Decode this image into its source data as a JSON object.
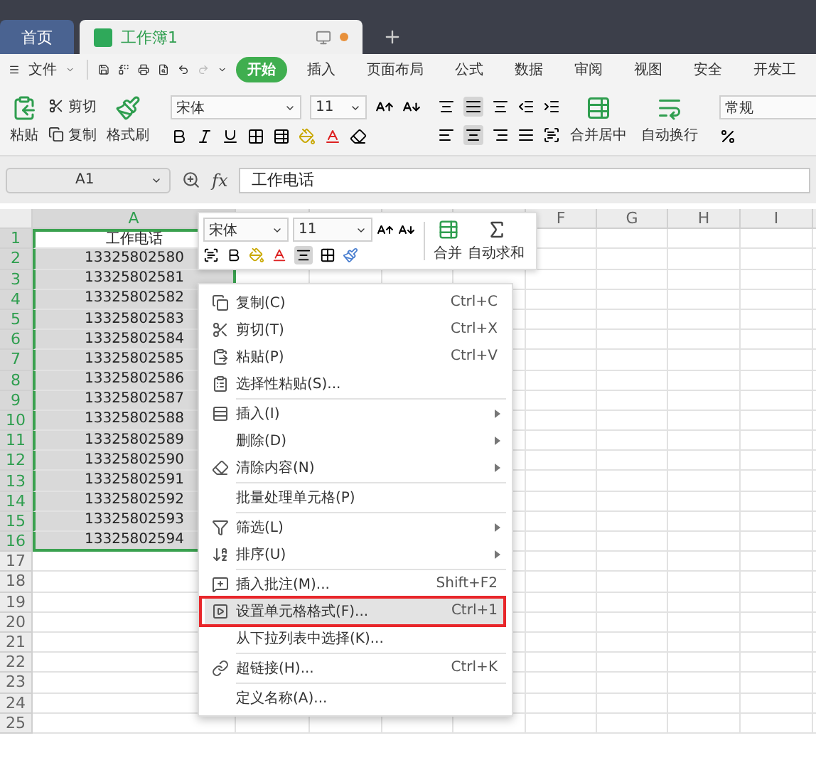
{
  "title_bar": {
    "tabs": [
      {
        "label": "首页",
        "selected": false,
        "unsaved": false
      },
      {
        "label": "工作簿1",
        "selected": true,
        "unsaved": true
      }
    ]
  },
  "menu_bar": {
    "file": "文件",
    "tabs": [
      {
        "label": "开始",
        "selected": true
      },
      {
        "label": "插入",
        "selected": false
      },
      {
        "label": "页面布局",
        "selected": false
      },
      {
        "label": "公式",
        "selected": false
      },
      {
        "label": "数据",
        "selected": false
      },
      {
        "label": "审阅",
        "selected": false
      },
      {
        "label": "视图",
        "selected": false
      },
      {
        "label": "安全",
        "selected": false
      },
      {
        "label": "开发工",
        "selected": false
      }
    ]
  },
  "ribbon": {
    "paste": "粘贴",
    "cut": "剪切",
    "copy": "复制",
    "format_painter": "格式刷",
    "font": "宋体",
    "font_size": "11",
    "merge_center": "合并居中",
    "wrap_text": "自动换行",
    "number_format": "常规"
  },
  "formula_bar": {
    "name_box": "A1",
    "fx": "fx",
    "value": "工作电话"
  },
  "sheet": {
    "columns": [
      {
        "label": "A",
        "selected": true
      },
      {
        "selected": false
      },
      {
        "selected": false
      },
      {
        "selected": false
      },
      {
        "selected": false
      },
      {
        "label": "F",
        "selected": false
      },
      {
        "label": "G",
        "selected": false
      },
      {
        "label": "H",
        "selected": false
      },
      {
        "label": "I",
        "selected": false
      }
    ],
    "rows": [
      {
        "number": "1",
        "value": "工作电话",
        "selected": true
      },
      {
        "number": "2",
        "value": "13325802580",
        "selected": true
      },
      {
        "number": "3",
        "value": "13325802581",
        "selected": true
      },
      {
        "number": "4",
        "value": "13325802582",
        "selected": true
      },
      {
        "number": "5",
        "value": "13325802583",
        "selected": true
      },
      {
        "number": "6",
        "value": "13325802584",
        "selected": true
      },
      {
        "number": "7",
        "value": "13325802585",
        "selected": true
      },
      {
        "number": "8",
        "value": "13325802586",
        "selected": true
      },
      {
        "number": "9",
        "value": "13325802587",
        "selected": true
      },
      {
        "number": "10",
        "value": "13325802588",
        "selected": true
      },
      {
        "number": "11",
        "value": "13325802589",
        "selected": true
      },
      {
        "number": "12",
        "value": "13325802590",
        "selected": true
      },
      {
        "number": "13",
        "value": "13325802591",
        "selected": true
      },
      {
        "number": "14",
        "value": "13325802592",
        "selected": true
      },
      {
        "number": "15",
        "value": "13325802593",
        "selected": true
      },
      {
        "number": "16",
        "value": "13325802594",
        "selected": true
      },
      {
        "number": "17",
        "selected": false
      },
      {
        "number": "18",
        "selected": false
      },
      {
        "number": "19",
        "selected": false
      },
      {
        "number": "20",
        "selected": false
      },
      {
        "number": "21",
        "selected": false
      },
      {
        "number": "22",
        "selected": false
      },
      {
        "number": "23",
        "selected": false
      },
      {
        "number": "24",
        "selected": false
      },
      {
        "number": "25",
        "selected": false
      }
    ]
  },
  "mini_toolbar": {
    "font": "宋体",
    "font_size": "11",
    "merge": "合并",
    "autosum": "自动求和"
  },
  "context_menu": {
    "items": [
      {
        "kind": "copy",
        "label": "复制(C)",
        "shortcut": "Ctrl+C",
        "submenu": false,
        "selected": false,
        "divider_after": false
      },
      {
        "kind": "cut",
        "label": "剪切(T)",
        "shortcut": "Ctrl+X",
        "submenu": false,
        "selected": false,
        "divider_after": false
      },
      {
        "kind": "paste",
        "label": "粘贴(P)",
        "shortcut": "Ctrl+V",
        "submenu": false,
        "selected": false,
        "divider_after": false
      },
      {
        "kind": "paste-special",
        "label": "选择性粘贴(S)...",
        "submenu": false,
        "selected": false,
        "divider_after": true
      },
      {
        "kind": "insert",
        "label": "插入(I)",
        "submenu": true,
        "selected": false,
        "divider_after": false
      },
      {
        "kind": "plain",
        "label": "删除(D)",
        "submenu": true,
        "selected": false,
        "divider_after": false
      },
      {
        "kind": "clear",
        "label": "清除内容(N)",
        "submenu": true,
        "selected": false,
        "divider_after": true
      },
      {
        "kind": "plain",
        "label": "批量处理单元格(P)",
        "submenu": false,
        "selected": false,
        "divider_after": true
      },
      {
        "kind": "filter",
        "label": "筛选(L)",
        "submenu": true,
        "selected": false,
        "divider_after": false
      },
      {
        "kind": "sort",
        "label": "排序(U)",
        "submenu": true,
        "selected": false,
        "divider_after": true
      },
      {
        "kind": "comment",
        "label": "插入批注(M)...",
        "shortcut": "Shift+F2",
        "submenu": false,
        "selected": false,
        "divider_after": false
      },
      {
        "kind": "format",
        "label": "设置单元格格式(F)...",
        "shortcut": "Ctrl+1",
        "submenu": false,
        "selected": true,
        "divider_after": false
      },
      {
        "kind": "plain",
        "label": "从下拉列表中选择(K)...",
        "submenu": false,
        "selected": false,
        "divider_after": true
      },
      {
        "kind": "link",
        "label": "超链接(H)...",
        "shortcut": "Ctrl+K",
        "submenu": false,
        "selected": false,
        "divider_after": true
      },
      {
        "kind": "plain",
        "label": "定义名称(A)...",
        "submenu": false,
        "selected": false,
        "divider_after": false
      }
    ]
  }
}
